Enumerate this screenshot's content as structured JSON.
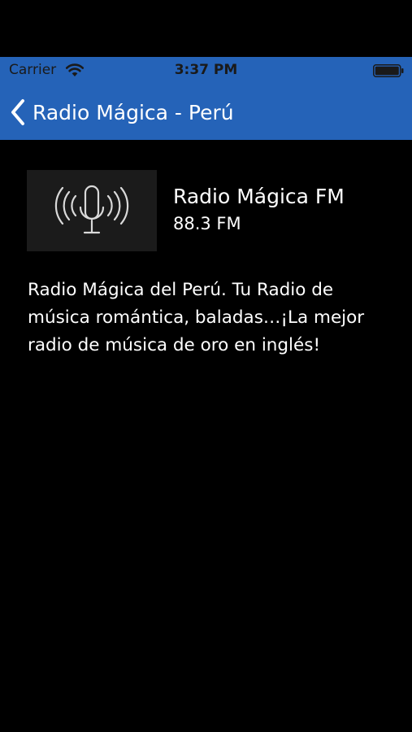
{
  "status_bar": {
    "carrier": "Carrier",
    "time": "3:37 PM",
    "wifi_icon": "wifi-icon",
    "battery_icon": "battery-icon"
  },
  "nav": {
    "back_icon": "chevron-left-icon",
    "title": "Radio Mágica - Perú",
    "bar_color": "#2563b8"
  },
  "station": {
    "logo_icon": "microphone-broadcast-icon",
    "name": "Radio Mágica FM",
    "frequency": "88.3 FM"
  },
  "description": "Radio Mágica del Perú. Tu Radio de música romántica, baladas…¡La mejor radio de música de oro en inglés!"
}
